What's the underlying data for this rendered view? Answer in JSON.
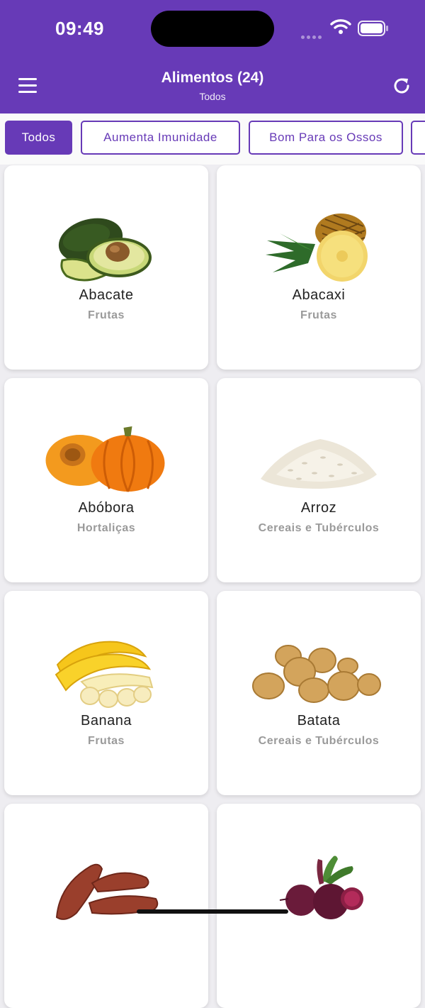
{
  "status": {
    "time": "09:49"
  },
  "header": {
    "title": "Alimentos (24)",
    "subtitle": "Todos",
    "menu_icon": "hamburger-menu-icon",
    "refresh_icon": "refresh-icon"
  },
  "filters": [
    "Todos",
    "Aumenta Imunidade",
    "Bom Para os Ossos"
  ],
  "foods": [
    {
      "name": "Abacate",
      "category": "Frutas"
    },
    {
      "name": "Abacaxi",
      "category": "Frutas"
    },
    {
      "name": "Abóbora",
      "category": "Hortaliças"
    },
    {
      "name": "Arroz",
      "category": "Cereais e Tubérculos"
    },
    {
      "name": "Banana",
      "category": "Frutas"
    },
    {
      "name": "Batata",
      "category": "Cereais e Tubérculos"
    },
    {
      "name": "",
      "category": ""
    },
    {
      "name": "",
      "category": ""
    }
  ],
  "colors": {
    "primary": "#673ab7",
    "background": "#eeedf1"
  }
}
